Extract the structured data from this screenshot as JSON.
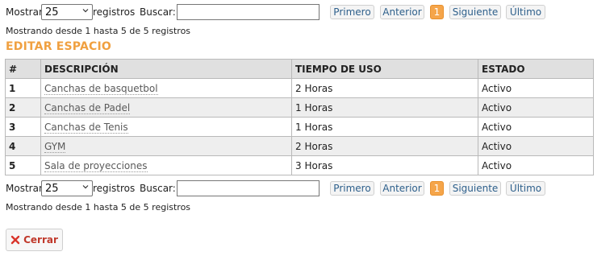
{
  "pagination_top": {
    "show_label": "Mostrar",
    "page_size": "25",
    "records_label": "registros",
    "search_label": "Buscar:",
    "search_value": "",
    "first": "Primero",
    "prev": "Anterior",
    "current_page": "1",
    "next": "Siguiente",
    "last": "Último"
  },
  "info_top": "Mostrando desde 1 hasta 5 de 5 registros",
  "section_title": "EDITAR ESPACIO",
  "table": {
    "headers": [
      "#",
      "DESCRIPCIÓN",
      "TIEMPO DE USO",
      "ESTADO"
    ],
    "rows": [
      {
        "num": "1",
        "desc": "Canchas de basquetbol",
        "time": "2 Horas",
        "status": "Activo"
      },
      {
        "num": "2",
        "desc": "Canchas de Padel",
        "time": "1 Horas",
        "status": "Activo"
      },
      {
        "num": "3",
        "desc": "Canchas de Tenis",
        "time": "1 Horas",
        "status": "Activo"
      },
      {
        "num": "4",
        "desc": "GYM",
        "time": "2 Horas",
        "status": "Activo"
      },
      {
        "num": "5",
        "desc": "Sala de proyecciones",
        "time": "3 Horas",
        "status": "Activo"
      }
    ]
  },
  "pagination_bottom": {
    "show_label": "Mostrar",
    "page_size": "25",
    "records_label": "registros",
    "search_label": "Buscar:",
    "search_value": "",
    "first": "Primero",
    "prev": "Anterior",
    "current_page": "1",
    "next": "Siguiente",
    "last": "Último"
  },
  "info_bottom": "Mostrando desde 1 hasta 5 de 5 registros",
  "close_label": "Cerrar",
  "colors": {
    "accent": "#f0a040",
    "active_page": "#f5a54a",
    "close_icon": "#d9342b"
  }
}
